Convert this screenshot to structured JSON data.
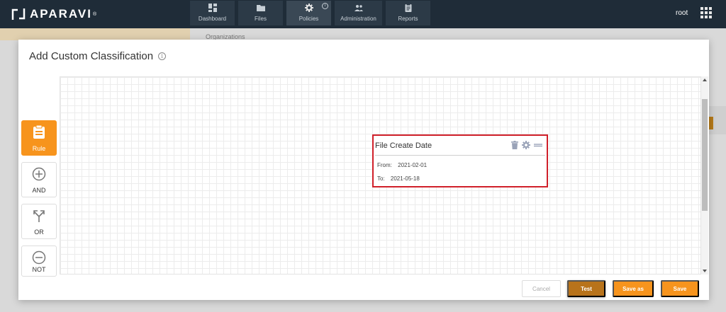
{
  "brand": {
    "name": "APARAVI",
    "reg": "®"
  },
  "nav": [
    {
      "label": "Dashboard"
    },
    {
      "label": "Files"
    },
    {
      "label": "Policies"
    },
    {
      "label": "Administration"
    },
    {
      "label": "Reports"
    }
  ],
  "nav_badge": "i",
  "user": {
    "name": "root"
  },
  "background": {
    "breadcrumb": "Organizations"
  },
  "modal": {
    "title": "Add Custom Classification",
    "info": "i"
  },
  "palette": {
    "rule": "Rule",
    "and": "AND",
    "or": "OR",
    "not": "NOT"
  },
  "card": {
    "title": "File Create Date",
    "from_label": "From:",
    "from_value": "2021-02-01",
    "to_label": "To:",
    "to_value": "2021-05-18"
  },
  "footer": {
    "cancel": "Cancel",
    "test": "Test",
    "save_as": "Save as",
    "save": "Save"
  },
  "colors": {
    "topbar": "#1f2c38",
    "accent": "#f7941d",
    "accent_dark": "#b8731b",
    "highlight": "#d0202a"
  }
}
